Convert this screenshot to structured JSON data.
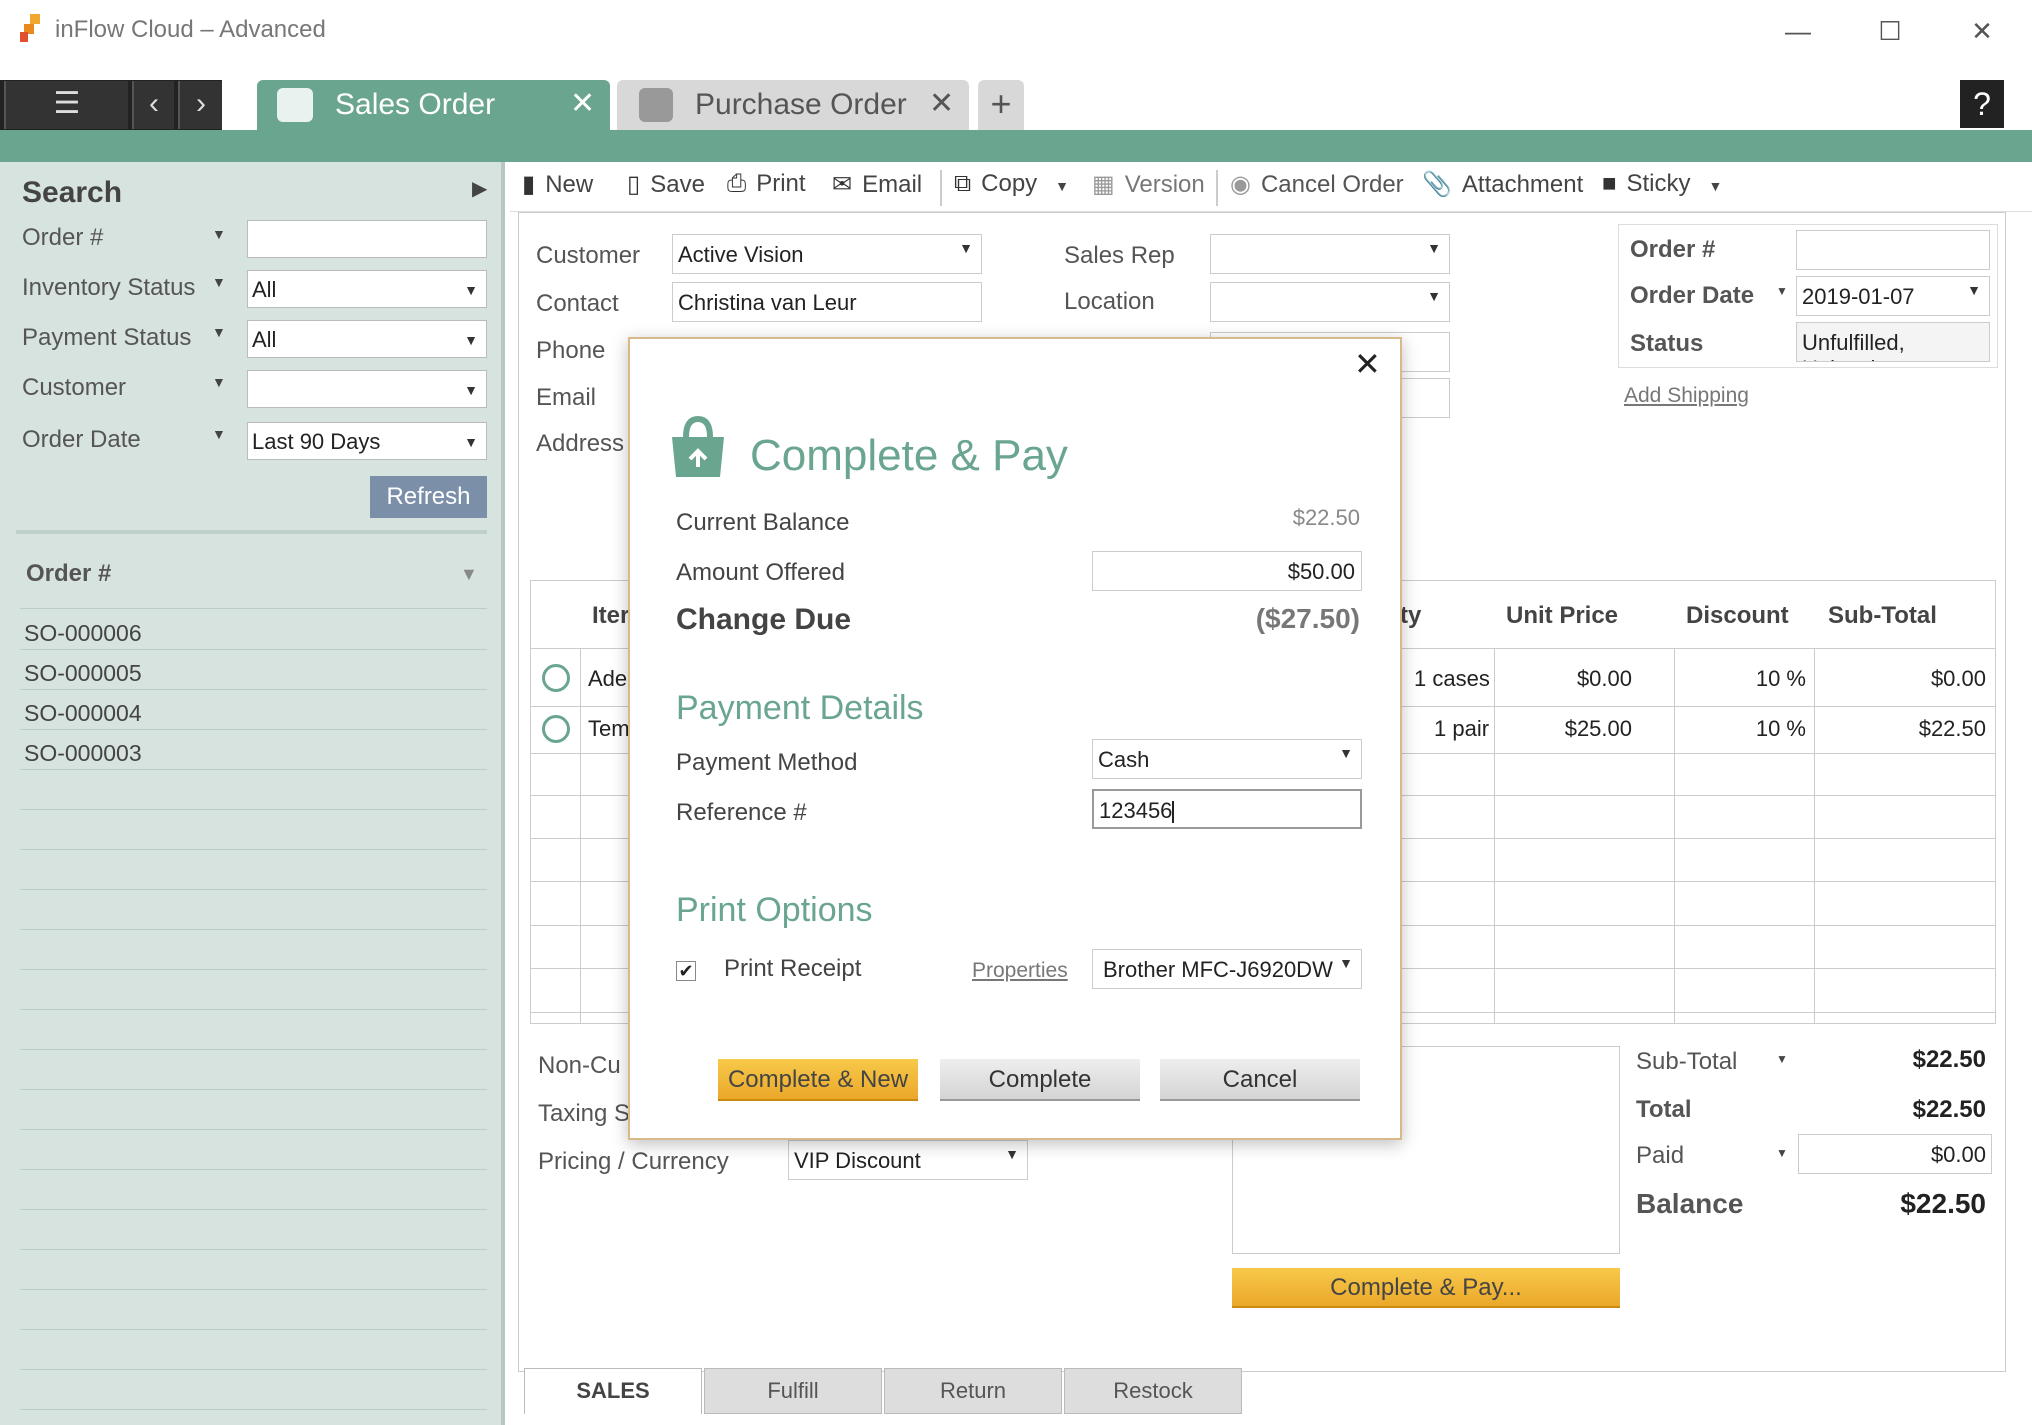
{
  "window": {
    "title": "inFlow Cloud – Advanced"
  },
  "tabs": [
    {
      "label": "Sales Order"
    },
    {
      "label": "Purchase Order"
    }
  ],
  "help_label": "?",
  "search": {
    "title": "Search",
    "filters": [
      {
        "label": "Order #",
        "value": ""
      },
      {
        "label": "Inventory Status",
        "value": "All"
      },
      {
        "label": "Payment Status",
        "value": "All"
      },
      {
        "label": "Customer",
        "value": ""
      },
      {
        "label": "Order Date",
        "value": "Last 90 Days"
      }
    ],
    "refresh_label": "Refresh",
    "list_header": "Order #",
    "orders": [
      "SO-000006",
      "SO-000005",
      "SO-000004",
      "SO-000003"
    ]
  },
  "toolbar": {
    "new": "New",
    "save": "Save",
    "print": "Print",
    "email": "Email",
    "copy": "Copy",
    "version": "Version",
    "cancel_order": "Cancel Order",
    "attachment": "Attachment",
    "sticky": "Sticky"
  },
  "form": {
    "customer_label": "Customer",
    "customer_value": "Active Vision",
    "contact_label": "Contact",
    "contact_value": "Christina van Leur",
    "phone_label": "Phone",
    "email_label": "Email",
    "address_label": "Address",
    "sales_rep_label": "Sales Rep",
    "location_label": "Location",
    "order_no_label": "Order #",
    "order_no_value": "",
    "order_date_label": "Order Date",
    "order_date_value": "2019-01-07",
    "status_label": "Status",
    "status_value": "Unfulfilled, Uninvoic",
    "add_shipping": "Add Shipping"
  },
  "grid": {
    "headers": {
      "item": "Iter",
      "qty": "ty",
      "unit_price": "Unit Price",
      "discount": "Discount",
      "subtotal": "Sub-Total"
    },
    "rows": [
      {
        "item": "Adep",
        "qty": "1 cases",
        "unit_price": "$0.00",
        "discount": "10 %",
        "subtotal": "$0.00"
      },
      {
        "item": "Tem",
        "qty": "1 pair",
        "unit_price": "$25.00",
        "discount": "10 %",
        "subtotal": "$22.50"
      }
    ]
  },
  "bottom": {
    "non_customer_label": "Non-Cu",
    "taxing_label": "Taxing S",
    "pricing_label": "Pricing / Currency",
    "pricing_value": "VIP Discount"
  },
  "totals": {
    "subtotal_label": "Sub-Total",
    "subtotal_value": "$22.50",
    "total_label": "Total",
    "total_value": "$22.50",
    "paid_label": "Paid",
    "paid_value": "$0.00",
    "balance_label": "Balance",
    "balance_value": "$22.50",
    "complete_pay_label": "Complete & Pay..."
  },
  "bottom_tabs": [
    "SALES",
    "Fulfill",
    "Return",
    "Restock"
  ],
  "dialog": {
    "title": "Complete & Pay",
    "current_balance_label": "Current Balance",
    "current_balance_value": "$22.50",
    "amount_offered_label": "Amount Offered",
    "amount_offered_value": "$50.00",
    "change_due_label": "Change Due",
    "change_due_value": "($27.50)",
    "payment_details_title": "Payment Details",
    "payment_method_label": "Payment Method",
    "payment_method_value": "Cash",
    "reference_label": "Reference #",
    "reference_value": "123456",
    "print_options_title": "Print Options",
    "print_receipt_label": "Print Receipt",
    "print_receipt_checked": true,
    "properties_label": "Properties",
    "printer_value": "Brother MFC-J6920DW",
    "complete_new_label": "Complete & New",
    "complete_label": "Complete",
    "cancel_label": "Cancel"
  },
  "colors": {
    "accent_green": "#6aa58f",
    "left_panel_bg": "#d7e3de",
    "orange_button": "#f0b33a",
    "dialog_border": "#d9b88a"
  }
}
